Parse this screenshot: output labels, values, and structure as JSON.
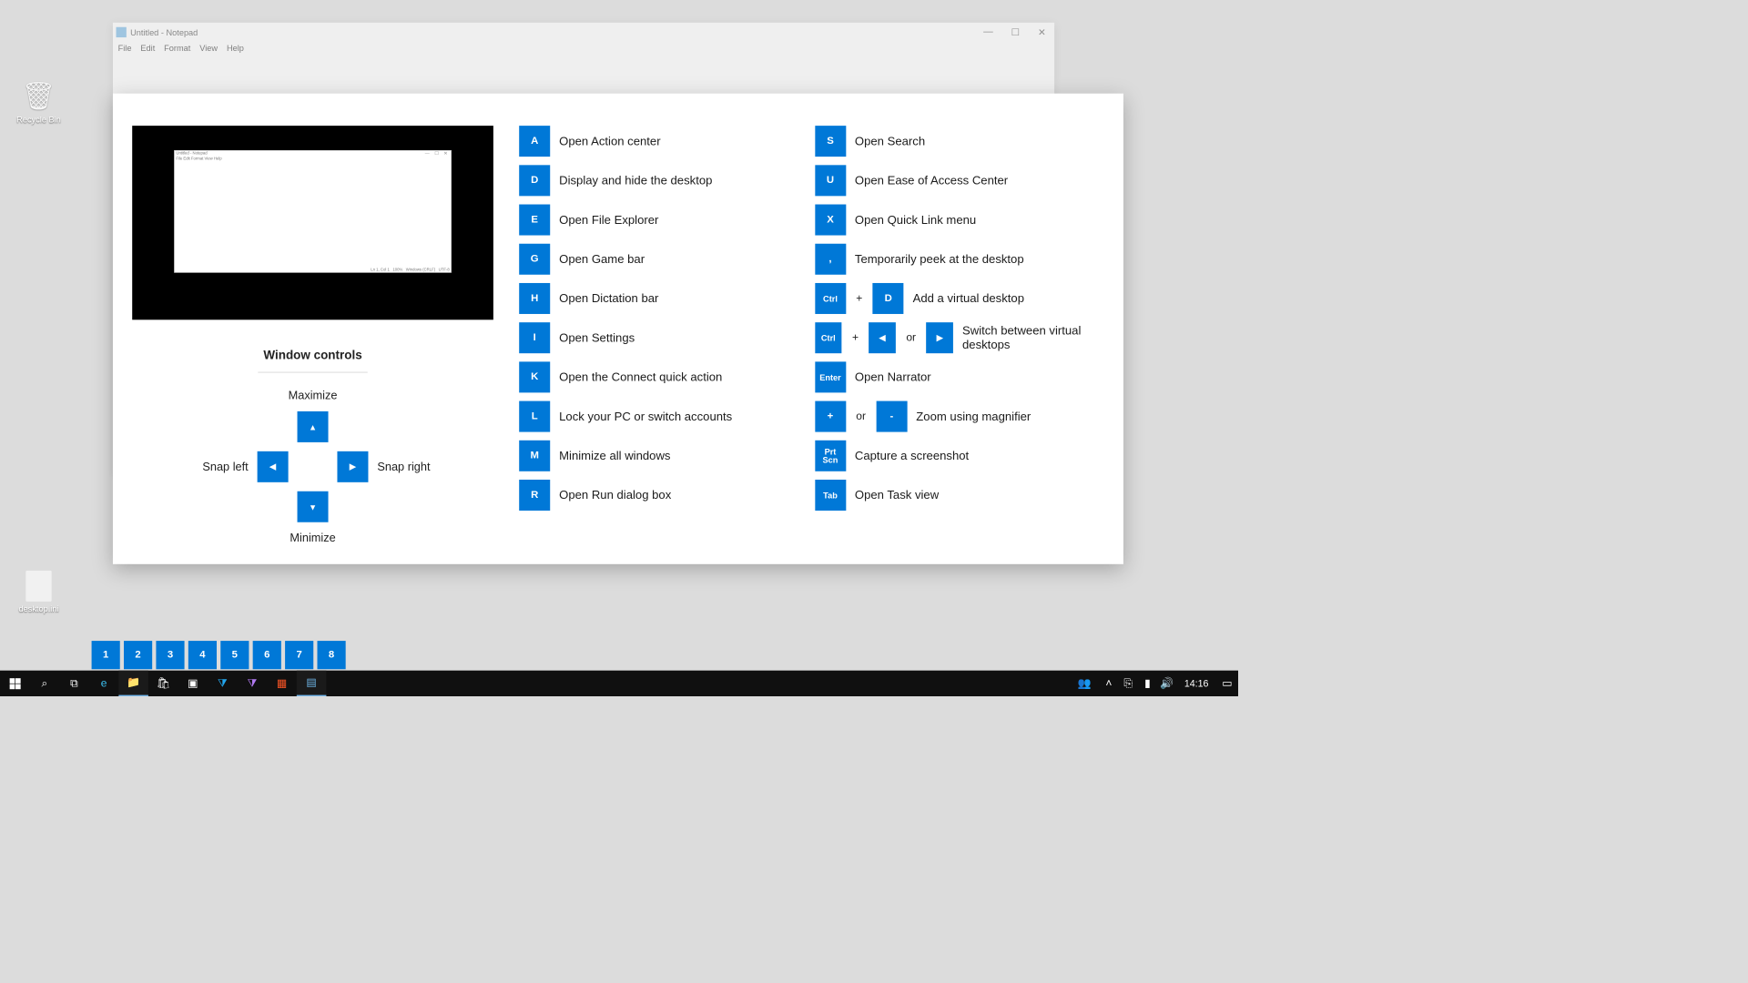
{
  "desktop_icons": {
    "recycle": "Recycle Bin",
    "ini": "desktop.ini"
  },
  "notepad": {
    "title": "Untitled - Notepad",
    "menu": [
      "File",
      "Edit",
      "Format",
      "View",
      "Help"
    ],
    "status": {
      "pos": "Ln 1, Col 1",
      "zoom": "100%",
      "eol": "Windows (CRLF)",
      "enc": "UTF-8"
    }
  },
  "overlay": {
    "window_controls": {
      "title": "Window controls",
      "maximize": "Maximize",
      "minimize": "Minimize",
      "snap_left": "Snap left",
      "snap_right": "Snap right"
    },
    "col1": [
      {
        "k": "A",
        "d": "Open Action center"
      },
      {
        "k": "D",
        "d": "Display and hide the desktop"
      },
      {
        "k": "E",
        "d": "Open File Explorer"
      },
      {
        "k": "G",
        "d": "Open Game bar"
      },
      {
        "k": "H",
        "d": "Open Dictation bar"
      },
      {
        "k": "I",
        "d": "Open Settings"
      },
      {
        "k": "K",
        "d": "Open the Connect quick action"
      },
      {
        "k": "L",
        "d": "Lock your PC or switch accounts"
      },
      {
        "k": "M",
        "d": "Minimize all windows"
      },
      {
        "k": "R",
        "d": "Open Run dialog box"
      }
    ],
    "col2_simple": [
      {
        "k": "S",
        "d": "Open Search"
      },
      {
        "k": "U",
        "d": "Open Ease of Access Center"
      },
      {
        "k": "X",
        "d": "Open Quick Link menu"
      },
      {
        "k": ",",
        "d": "Temporarily peek at the desktop"
      }
    ],
    "col2_ctrl_d": {
      "k1": "Ctrl",
      "plus": "+",
      "k2": "D",
      "d": "Add a virtual desktop"
    },
    "col2_ctrl_arrows": {
      "k1": "Ctrl",
      "plus": "+",
      "or": "or",
      "d": "Switch between virtual desktops"
    },
    "col2_enter": {
      "k": "Enter",
      "d": "Open Narrator"
    },
    "col2_zoom": {
      "k1": "+",
      "or": "or",
      "k2": "-",
      "d": "Zoom using magnifier"
    },
    "col2_prtscn": {
      "k": "Prt Scn",
      "d": "Capture a screenshot"
    },
    "col2_tab": {
      "k": "Tab",
      "d": "Open Task view"
    }
  },
  "numbers": [
    "1",
    "2",
    "3",
    "4",
    "5",
    "6",
    "7",
    "8"
  ],
  "taskbar": {
    "time": "14:16"
  }
}
